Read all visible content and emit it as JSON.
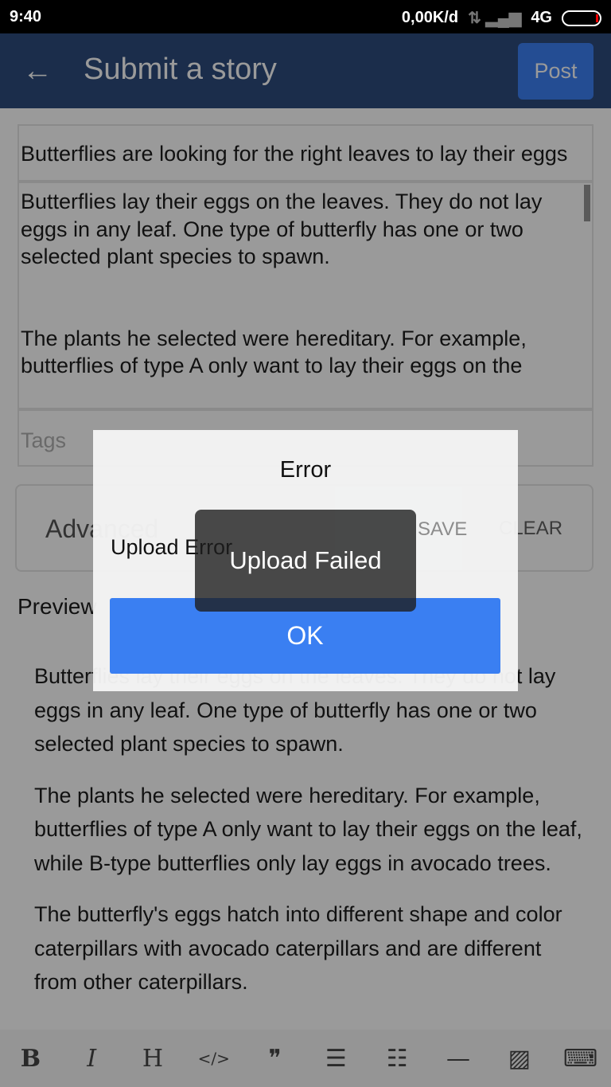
{
  "status": {
    "time": "9:40",
    "speed": "0,00K/d",
    "network": "4G"
  },
  "header": {
    "back_icon": "arrow-left-icon",
    "title": "Submit a story",
    "post_label": "Post"
  },
  "form": {
    "title_value": "Butterflies are looking for the right leaves to lay their eggs",
    "body_lines": [
      "Butterflies lay their eggs on the leaves. They do not lay eggs in any leaf. One type of butterfly has one or two selected plant species to spawn.",
      "",
      "",
      "The plants he selected were hereditary. For example, butterflies of type A only want to lay their eggs on the"
    ],
    "tags_placeholder": "Tags",
    "advanced_label": "Advanced",
    "save_label": "SAVE",
    "clear_label": "CLEAR"
  },
  "preview": {
    "label": "Preview",
    "paragraphs": [
      "Butterflies lay their eggs on the leaves. They do not lay eggs in any leaf. One type of butterfly has one or two selected plant species to spawn.",
      "The plants he selected were hereditary. For example, butterflies of type A only want to lay their eggs on the leaf, while B-type butterflies only lay eggs in avocado trees.",
      "The butterfly's eggs hatch into different shape and color caterpillars with avocado caterpillars and are different from other caterpillars."
    ]
  },
  "toolbar": {
    "items": [
      {
        "name": "bold",
        "glyph": "B"
      },
      {
        "name": "italic",
        "glyph": "I"
      },
      {
        "name": "heading",
        "glyph": "H"
      },
      {
        "name": "code",
        "glyph": "</>"
      },
      {
        "name": "quote",
        "glyph": "❞"
      },
      {
        "name": "ordered-list",
        "glyph": "☰"
      },
      {
        "name": "unordered-list",
        "glyph": "☷"
      },
      {
        "name": "horizontal-rule",
        "glyph": "—"
      },
      {
        "name": "image",
        "glyph": "▨"
      },
      {
        "name": "keyboard",
        "glyph": "⌨"
      }
    ]
  },
  "dialog": {
    "title": "Error",
    "message": "Upload Error",
    "ok_label": "OK"
  },
  "toast": {
    "message": "Upload Failed"
  }
}
